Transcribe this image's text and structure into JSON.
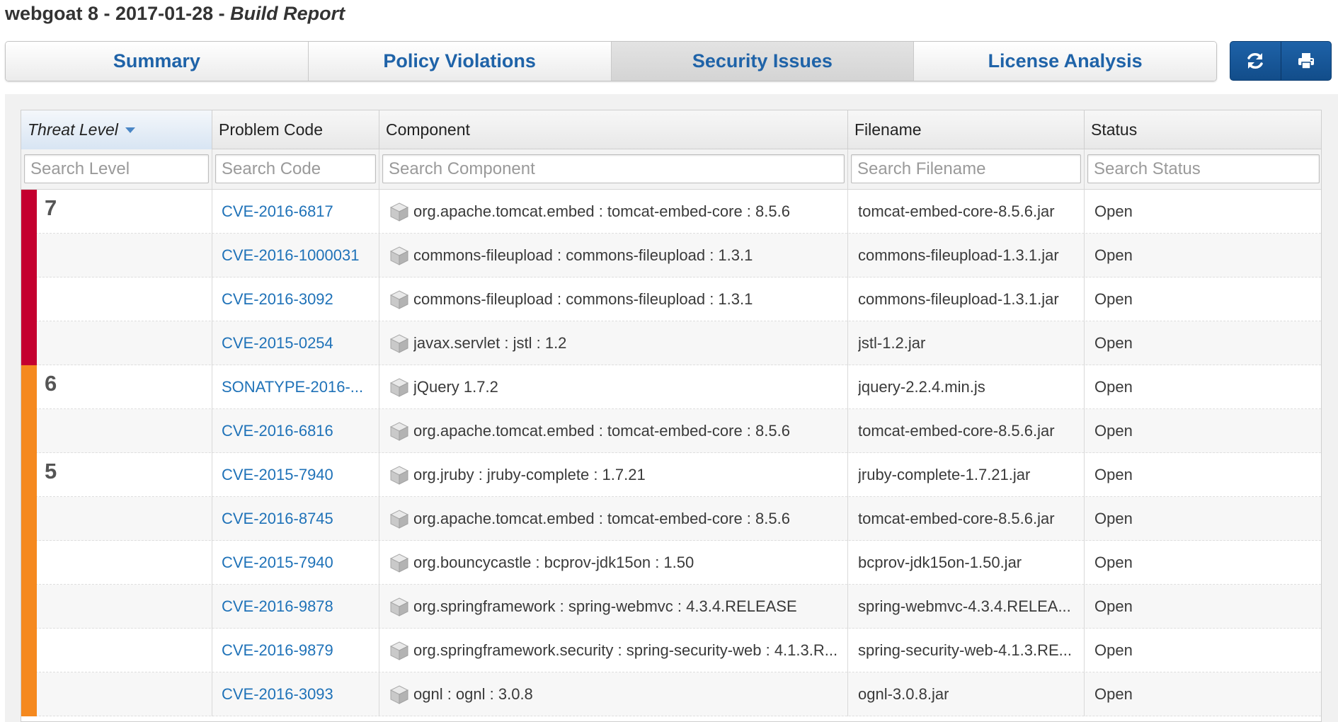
{
  "header": {
    "app": "webgoat 8",
    "sep1": " - ",
    "date": "2017-01-28",
    "sep2": " - ",
    "report": "Build Report"
  },
  "tabs": [
    {
      "label": "Summary",
      "active": false
    },
    {
      "label": "Policy Violations",
      "active": false
    },
    {
      "label": "Security Issues",
      "active": true
    },
    {
      "label": "License Analysis",
      "active": false
    }
  ],
  "actions": {
    "refresh_icon": "refresh-icon",
    "print_icon": "print-icon"
  },
  "columns": {
    "threat_level": "Threat Level",
    "problem_code": "Problem Code",
    "component": "Component",
    "filename": "Filename",
    "status": "Status"
  },
  "filters": {
    "level": "Search Level",
    "code": "Search Code",
    "component": "Search Component",
    "filename": "Search Filename",
    "status": "Search Status"
  },
  "colors": {
    "level_7": "#c4002f",
    "level_6": "#f5891f",
    "level_5": "#f5891f",
    "link": "#1f72b8",
    "accent": "#1e62a8"
  },
  "rows": [
    {
      "level": "7",
      "show_level": true,
      "code": "CVE-2016-6817",
      "component": "org.apache.tomcat.embed : tomcat-embed-core : 8.5.6",
      "filename": "tomcat-embed-core-8.5.6.jar",
      "status": "Open"
    },
    {
      "level": "7",
      "show_level": false,
      "code": "CVE-2016-1000031",
      "component": "commons-fileupload : commons-fileupload : 1.3.1",
      "filename": "commons-fileupload-1.3.1.jar",
      "status": "Open"
    },
    {
      "level": "7",
      "show_level": false,
      "code": "CVE-2016-3092",
      "component": "commons-fileupload : commons-fileupload : 1.3.1",
      "filename": "commons-fileupload-1.3.1.jar",
      "status": "Open"
    },
    {
      "level": "7",
      "show_level": false,
      "code": "CVE-2015-0254",
      "component": "javax.servlet : jstl : 1.2",
      "filename": "jstl-1.2.jar",
      "status": "Open"
    },
    {
      "level": "6",
      "show_level": true,
      "code": "SONATYPE-2016-...",
      "component": "jQuery 1.7.2",
      "filename": "jquery-2.2.4.min.js",
      "status": "Open"
    },
    {
      "level": "6",
      "show_level": false,
      "code": "CVE-2016-6816",
      "component": "org.apache.tomcat.embed : tomcat-embed-core : 8.5.6",
      "filename": "tomcat-embed-core-8.5.6.jar",
      "status": "Open"
    },
    {
      "level": "5",
      "show_level": true,
      "code": "CVE-2015-7940",
      "component": "org.jruby : jruby-complete : 1.7.21",
      "filename": "jruby-complete-1.7.21.jar",
      "status": "Open"
    },
    {
      "level": "5",
      "show_level": false,
      "code": "CVE-2016-8745",
      "component": "org.apache.tomcat.embed : tomcat-embed-core : 8.5.6",
      "filename": "tomcat-embed-core-8.5.6.jar",
      "status": "Open"
    },
    {
      "level": "5",
      "show_level": false,
      "code": "CVE-2015-7940",
      "component": "org.bouncycastle : bcprov-jdk15on : 1.50",
      "filename": "bcprov-jdk15on-1.50.jar",
      "status": "Open"
    },
    {
      "level": "5",
      "show_level": false,
      "code": "CVE-2016-9878",
      "component": "org.springframework : spring-webmvc : 4.3.4.RELEASE",
      "filename": "spring-webmvc-4.3.4.RELEA...",
      "status": "Open"
    },
    {
      "level": "5",
      "show_level": false,
      "code": "CVE-2016-9879",
      "component": "org.springframework.security : spring-security-web : 4.1.3.R...",
      "filename": "spring-security-web-4.1.3.RE...",
      "status": "Open"
    },
    {
      "level": "5",
      "show_level": false,
      "code": "CVE-2016-3093",
      "component": "ognl : ognl : 3.0.8",
      "filename": "ognl-3.0.8.jar",
      "status": "Open"
    }
  ]
}
